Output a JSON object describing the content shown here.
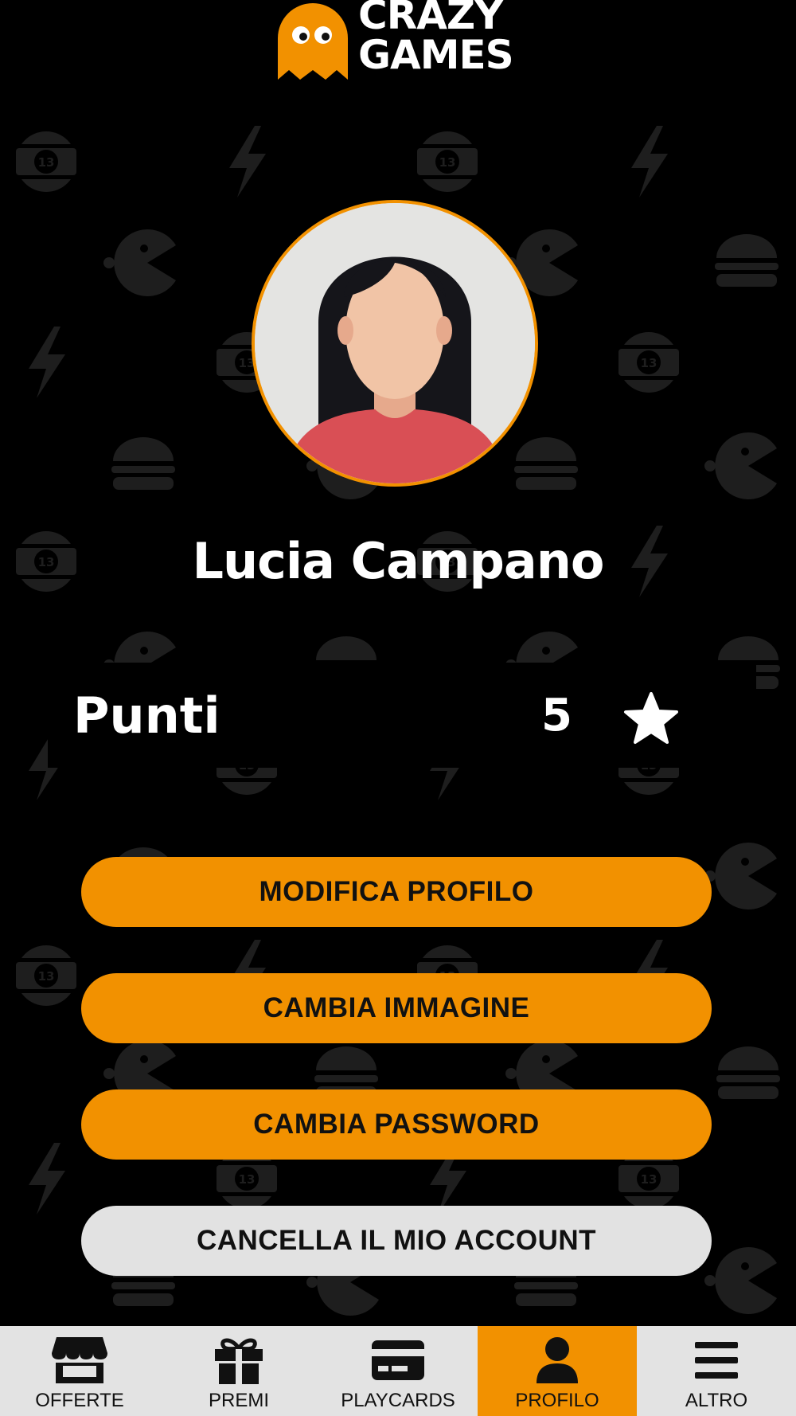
{
  "header": {
    "logo_line1": "CRAZY",
    "logo_line2": "GAMES"
  },
  "colors": {
    "accent": "#f29100",
    "background": "#000000",
    "pattern": "#1e1e1e",
    "tabbar": "#e3e3e3",
    "danger_button": "#e2e2e2"
  },
  "profile": {
    "name": "Lucia Campano"
  },
  "points": {
    "label": "Punti",
    "value": "5",
    "icon": "star-icon"
  },
  "actions": {
    "edit_profile": "MODIFICA PROFILO",
    "change_image": "CAMBIA IMMAGINE",
    "change_password": "CAMBIA PASSWORD",
    "delete_account": "CANCELLA IL MIO ACCOUNT"
  },
  "tabs": [
    {
      "label": "OFFERTE",
      "icon": "store-icon",
      "active": false
    },
    {
      "label": "PREMI",
      "icon": "gift-icon",
      "active": false
    },
    {
      "label": "PLAYCARDS",
      "icon": "card-icon",
      "active": false
    },
    {
      "label": "PROFILO",
      "icon": "user-icon",
      "active": true
    },
    {
      "label": "ALTRO",
      "icon": "menu-icon",
      "active": false
    }
  ]
}
